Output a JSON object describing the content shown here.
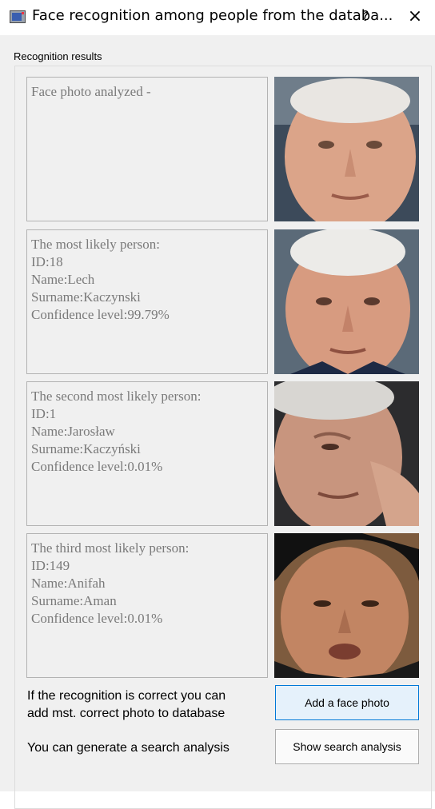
{
  "window": {
    "title": "Face recognition among people from the databa...",
    "help_label": "?",
    "close_label": "×"
  },
  "group": {
    "label": "Recognition results"
  },
  "panels": [
    {
      "lines": [
        "Face photo analyzed -"
      ],
      "photo": "face-photo"
    },
    {
      "lines": [
        "The most likely person:",
        "ID:18",
        "Name:Lech",
        "Surname:Kaczynski",
        "Confidence level:99.79%"
      ],
      "photo": "face-photo"
    },
    {
      "lines": [
        "The second most likely person:",
        "ID:1",
        "Name:Jarosław",
        "Surname:Kaczyński",
        "Confidence level:0.01%"
      ],
      "photo": "face-photo"
    },
    {
      "lines": [
        "The third most likely person:",
        "ID:149",
        "Name:Anifah",
        "Surname:Aman",
        "Confidence level:0.01%"
      ],
      "photo": "face-photo"
    }
  ],
  "footer": {
    "add_text_line1": "If the recognition is correct you can",
    "add_text_line2": "add mst. correct photo to database",
    "add_button": "Add a face photo",
    "analysis_text": "You can generate a search analysis",
    "analysis_button": "Show search analysis"
  },
  "colors": {
    "panel_text": "#7a7a7a",
    "window_bg": "#f0f0f0",
    "primary_border": "#0078d7"
  }
}
